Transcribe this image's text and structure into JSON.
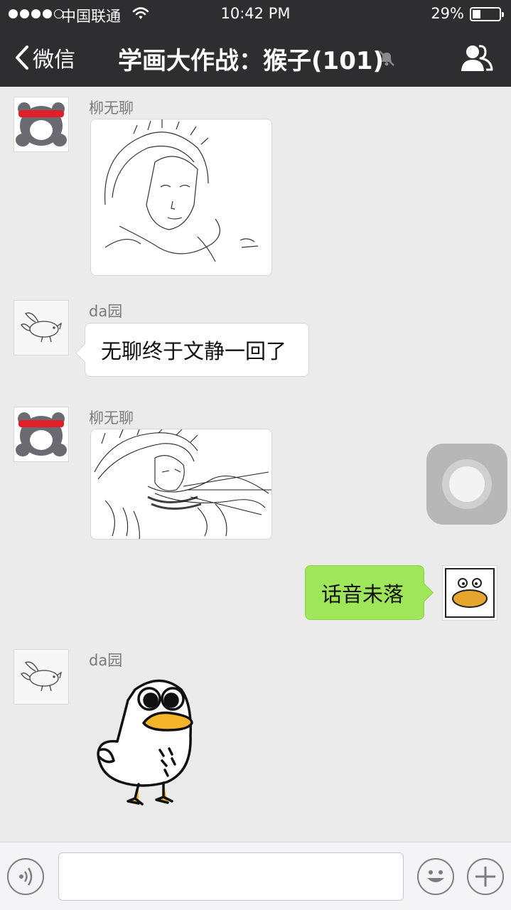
{
  "status_bar": {
    "carrier": "中国联通",
    "time": "10:42 PM",
    "battery_percent": "29%",
    "signal_bars_filled": 4,
    "signal_bars_total": 5
  },
  "nav": {
    "back_label": "微信",
    "title": "学画大作战：猴子(101)",
    "icons": [
      "chevron-left-icon",
      "mute-bell-icon",
      "group-members-icon"
    ]
  },
  "messages": [
    {
      "sender": "柳无聊",
      "type": "image",
      "content": "sketch-girl-with-animal-hood",
      "avatar": "bear-red-scarf-avatar"
    },
    {
      "sender": "da园",
      "type": "text",
      "text": "无聊终于文静一回了",
      "avatar": "flying-pig-avatar"
    },
    {
      "sender": "柳无聊",
      "type": "image",
      "content": "sketch-monkey-creature",
      "avatar": "bear-red-scarf-avatar"
    },
    {
      "sender": "me",
      "type": "text",
      "text": "话音未落",
      "avatar": "duck-face-avatar"
    },
    {
      "sender": "da园",
      "type": "sticker",
      "content": "white-duck-sticker",
      "avatar": "flying-pig-avatar"
    }
  ],
  "input_bar": {
    "value": "",
    "icons": [
      "voice-icon",
      "emoji-icon",
      "plus-icon"
    ]
  },
  "colors": {
    "nav_bg": "#2e2e31",
    "chat_bg": "#ebebeb",
    "sent_bubble": "#9fe65b",
    "received_bubble": "#ffffff"
  }
}
